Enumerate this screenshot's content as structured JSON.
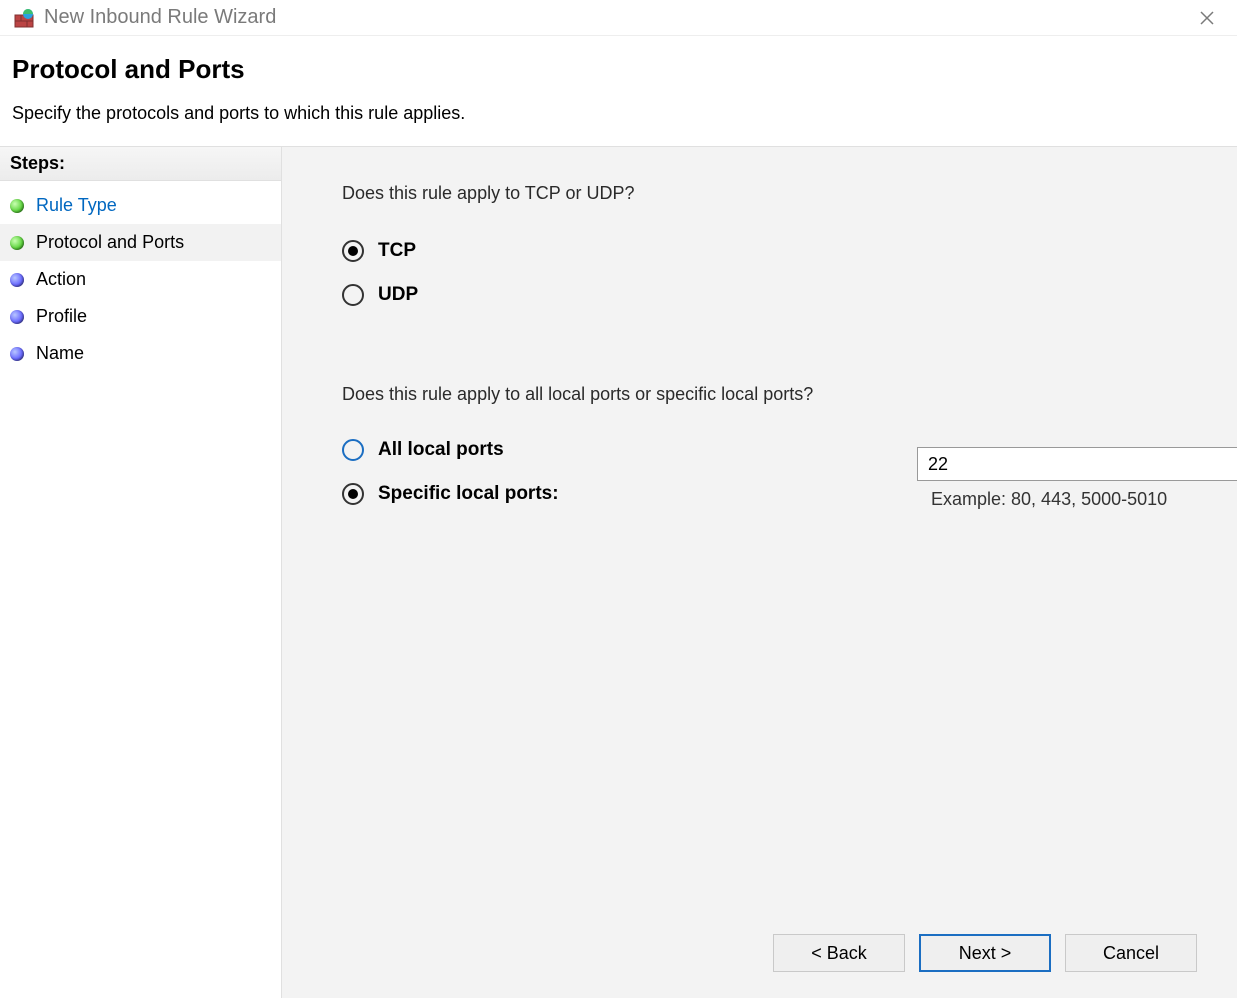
{
  "window": {
    "title": "New Inbound Rule Wizard"
  },
  "header": {
    "title": "Protocol and Ports",
    "subtitle": "Specify the protocols and ports to which this rule applies."
  },
  "sidebar": {
    "heading": "Steps:",
    "items": [
      {
        "label": "Rule Type",
        "state": "completed"
      },
      {
        "label": "Protocol and Ports",
        "state": "current"
      },
      {
        "label": "Action",
        "state": "pending"
      },
      {
        "label": "Profile",
        "state": "pending"
      },
      {
        "label": "Name",
        "state": "pending"
      }
    ]
  },
  "main": {
    "protocol": {
      "question": "Does this rule apply to TCP or UDP?",
      "tcp_label": "TCP",
      "udp_label": "UDP",
      "selected": "TCP"
    },
    "ports": {
      "question": "Does this rule apply to all local ports or specific local ports?",
      "all_label": "All local ports",
      "specific_label": "Specific local ports:",
      "selected": "specific",
      "specific_value": "22",
      "example_text": "Example: 80, 443, 5000-5010"
    }
  },
  "buttons": {
    "back": "< Back",
    "next": "Next >",
    "cancel": "Cancel"
  }
}
